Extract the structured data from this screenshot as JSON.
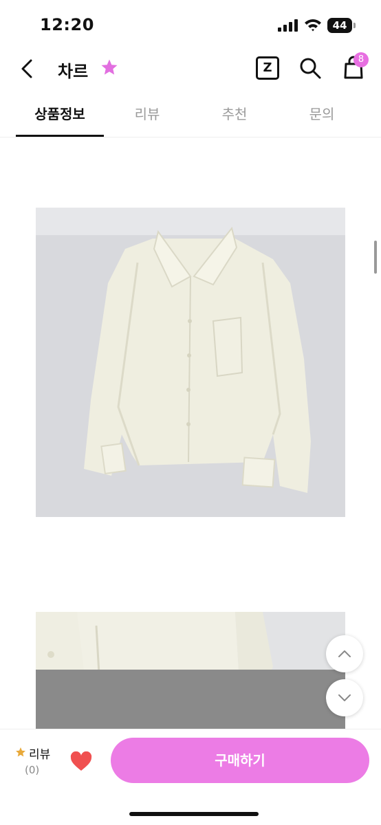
{
  "status": {
    "time": "12:20",
    "battery": "44"
  },
  "header": {
    "shop_name": "차르",
    "z_label": "Z",
    "cart_badge": "8",
    "favorite_color": "#e26fe0"
  },
  "tabs": [
    {
      "label": "상품정보",
      "active": true
    },
    {
      "label": "리뷰",
      "active": false
    },
    {
      "label": "추천",
      "active": false
    },
    {
      "label": "문의",
      "active": false
    }
  ],
  "bottom": {
    "review_label": "리뷰",
    "review_count": "(0)",
    "buy_label": "구매하기",
    "buy_color": "#ec7ce5",
    "heart_color": "#f05050"
  },
  "icons": [
    "back-icon",
    "star-icon",
    "z-icon",
    "search-icon",
    "shopping-bag-icon",
    "chevron-up-icon",
    "chevron-down-icon",
    "heart-icon"
  ]
}
